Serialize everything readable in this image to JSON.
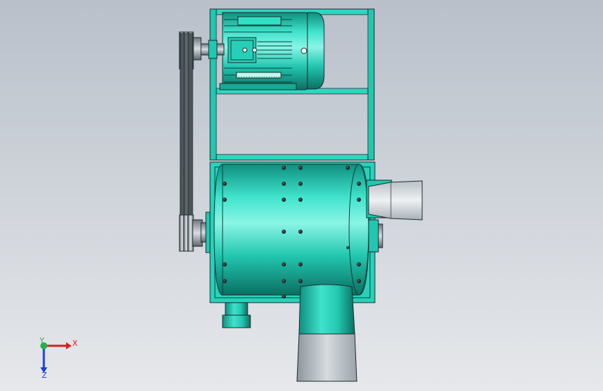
{
  "viewport": {
    "background_top": "#b9c0ca",
    "background_bottom": "#e6e8eb"
  },
  "model": {
    "body_color": "#1fc8b1",
    "body_highlight": "#7ef0df",
    "body_shadow": "#0c7d6e",
    "steel_color": "#9aa3ab",
    "outline_color": "#1a2a28"
  },
  "motor": {
    "nameplate_text": "...................."
  },
  "triad": {
    "x_label": "X",
    "y_label": "Y",
    "z_label": "Z",
    "x_color": "#d81e1e",
    "y_color": "#20b24a",
    "z_color": "#1e3fd8"
  }
}
